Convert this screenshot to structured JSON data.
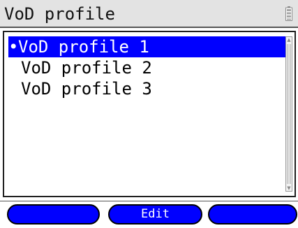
{
  "window": {
    "title": "VoD profile"
  },
  "icons": {
    "battery": "battery-icon",
    "scroll_up": "scroll-up-arrow-icon",
    "scroll_down": "scroll-down-arrow-icon"
  },
  "list": {
    "items": [
      {
        "bullet": "•",
        "label": "VoD profile 1",
        "selected": true
      },
      {
        "bullet": "",
        "label": "VoD profile 2",
        "selected": false
      },
      {
        "bullet": "",
        "label": "VoD profile 3",
        "selected": false
      }
    ]
  },
  "softkeys": {
    "left": "",
    "middle": "Edit",
    "right": ""
  },
  "colors": {
    "selection": "#0000ff",
    "softkey": "#0000ff",
    "titlebar": "#e3e3e3"
  }
}
